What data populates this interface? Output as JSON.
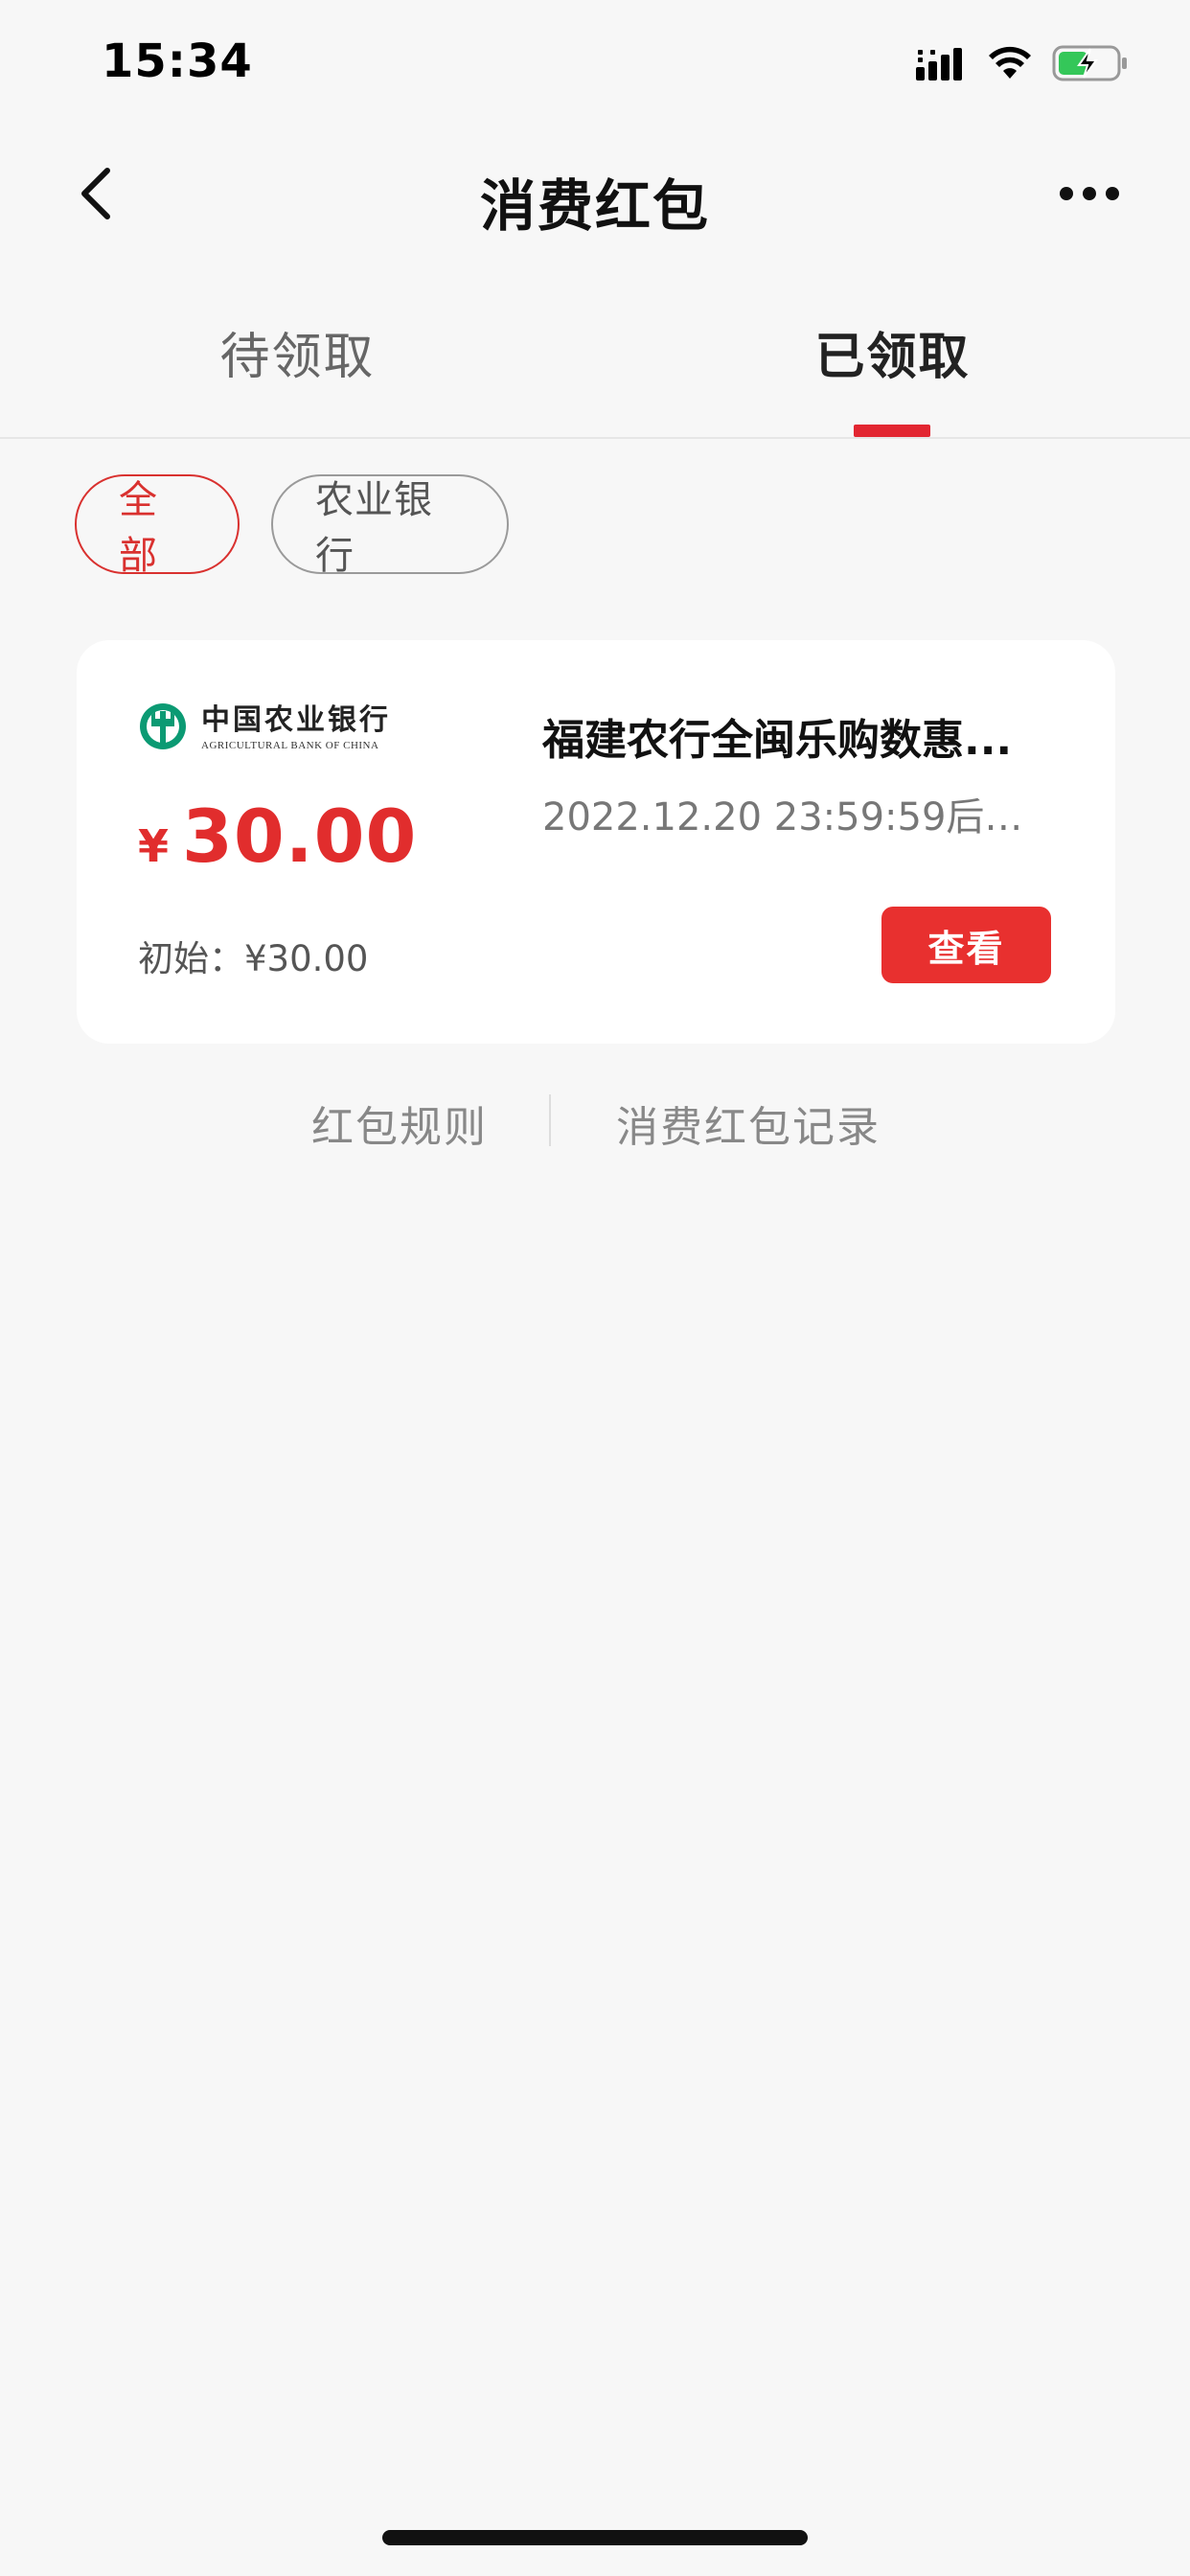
{
  "status_bar": {
    "time": "15:34",
    "icons": [
      "cellular-signal-icon",
      "wifi-icon",
      "battery-charging-icon"
    ]
  },
  "nav": {
    "title": "消费红包",
    "back_icon": "chevron-left-icon",
    "more_icon": "more-horizontal-icon"
  },
  "tabs": [
    {
      "label": "待领取",
      "active": false
    },
    {
      "label": "已领取",
      "active": true
    }
  ],
  "filters": [
    {
      "label": "全部",
      "active": true
    },
    {
      "label": "农业银行",
      "active": false
    }
  ],
  "card": {
    "bank_name_cn": "中国农业银行",
    "bank_name_en": "AGRICULTURAL BANK OF CHINA",
    "amount_symbol": "¥",
    "amount": "30.00",
    "initial_label": "初始：¥30.00",
    "title": "福建农行全闽乐购数惠...",
    "expiry": "2022.12.20 23:59:59后过...",
    "view_label": "查看"
  },
  "footer": {
    "rules_label": "红包规则",
    "records_label": "消费红包记录"
  },
  "colors": {
    "accent_red": "#e8302f",
    "bank_green": "#0b9a73",
    "background": "#f7f7f7"
  }
}
